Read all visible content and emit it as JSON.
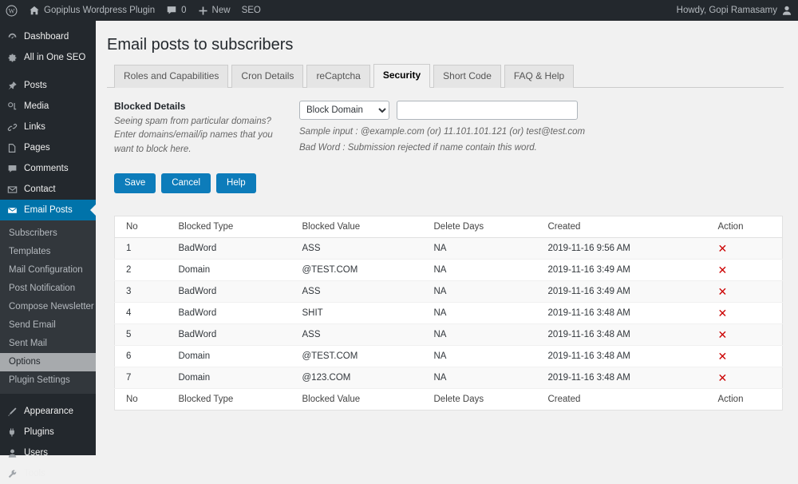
{
  "adminbar": {
    "site_name": "Gopiplus Wordpress Plugin",
    "comment_count": "0",
    "new_label": "New",
    "seo_label": "SEO",
    "howdy": "Howdy, Gopi Ramasamy"
  },
  "sidebar": {
    "top_items": [
      {
        "label": "Dashboard",
        "icon": "dashboard-icon"
      },
      {
        "label": "All in One SEO",
        "icon": "gear-icon"
      }
    ],
    "main_items": [
      {
        "label": "Posts",
        "icon": "pin-icon"
      },
      {
        "label": "Media",
        "icon": "media-icon"
      },
      {
        "label": "Links",
        "icon": "link-icon"
      },
      {
        "label": "Pages",
        "icon": "pages-icon"
      },
      {
        "label": "Comments",
        "icon": "comment-icon"
      },
      {
        "label": "Contact",
        "icon": "envelope-icon"
      }
    ],
    "current_item": {
      "label": "Email Posts",
      "icon": "email-icon"
    },
    "submenu": [
      {
        "label": "Subscribers",
        "current": false
      },
      {
        "label": "Templates",
        "current": false
      },
      {
        "label": "Mail Configuration",
        "current": false
      },
      {
        "label": "Post Notification",
        "current": false
      },
      {
        "label": "Compose Newsletter",
        "current": false
      },
      {
        "label": "Send Email",
        "current": false
      },
      {
        "label": "Sent Mail",
        "current": false
      },
      {
        "label": "Options",
        "current": true
      },
      {
        "label": "Plugin Settings",
        "current": false
      }
    ],
    "bottom_items": [
      {
        "label": "Appearance",
        "icon": "appearance-icon"
      },
      {
        "label": "Plugins",
        "icon": "plugin-icon"
      },
      {
        "label": "Users",
        "icon": "users-icon"
      },
      {
        "label": "Tools",
        "icon": "tools-icon"
      }
    ]
  },
  "page": {
    "title": "Email posts to subscribers",
    "tabs": [
      {
        "label": "Roles and Capabilities",
        "active": false
      },
      {
        "label": "Cron Details",
        "active": false
      },
      {
        "label": "reCaptcha",
        "active": false
      },
      {
        "label": "Security",
        "active": true
      },
      {
        "label": "Short Code",
        "active": false
      },
      {
        "label": "FAQ & Help",
        "active": false
      }
    ]
  },
  "form": {
    "label": "Blocked Details",
    "description": "Seeing spam from particular domains? Enter domains/email/ip names that you want to block here.",
    "select_value": "Block Domain",
    "select_options": [
      "Block Domain"
    ],
    "input_value": "",
    "input_placeholder": "",
    "hint_line1": "Sample input : @example.com (or) 11.101.101.121 (or) test@test.com",
    "hint_line2": "Bad Word : Submission rejected if name contain this word.",
    "buttons": {
      "save": "Save",
      "cancel": "Cancel",
      "help": "Help"
    },
    "accent_color": "#0d7cba"
  },
  "table": {
    "columns": [
      "No",
      "Blocked Type",
      "Blocked Value",
      "Delete Days",
      "Created",
      "Action"
    ],
    "delete_icon": "✕",
    "delete_color": "#cc0000",
    "rows": [
      {
        "no": "1",
        "type": "BadWord",
        "value": "ASS",
        "days": "NA",
        "created": "2019-11-16 9:56 AM"
      },
      {
        "no": "2",
        "type": "Domain",
        "value": "@TEST.COM",
        "days": "NA",
        "created": "2019-11-16 3:49 AM"
      },
      {
        "no": "3",
        "type": "BadWord",
        "value": "ASS",
        "days": "NA",
        "created": "2019-11-16 3:49 AM"
      },
      {
        "no": "4",
        "type": "BadWord",
        "value": "SHIT",
        "days": "NA",
        "created": "2019-11-16 3:48 AM"
      },
      {
        "no": "5",
        "type": "BadWord",
        "value": "ASS",
        "days": "NA",
        "created": "2019-11-16 3:48 AM"
      },
      {
        "no": "6",
        "type": "Domain",
        "value": "@TEST.COM",
        "days": "NA",
        "created": "2019-11-16 3:48 AM"
      },
      {
        "no": "7",
        "type": "Domain",
        "value": "@123.COM",
        "days": "NA",
        "created": "2019-11-16 3:48 AM"
      }
    ]
  }
}
